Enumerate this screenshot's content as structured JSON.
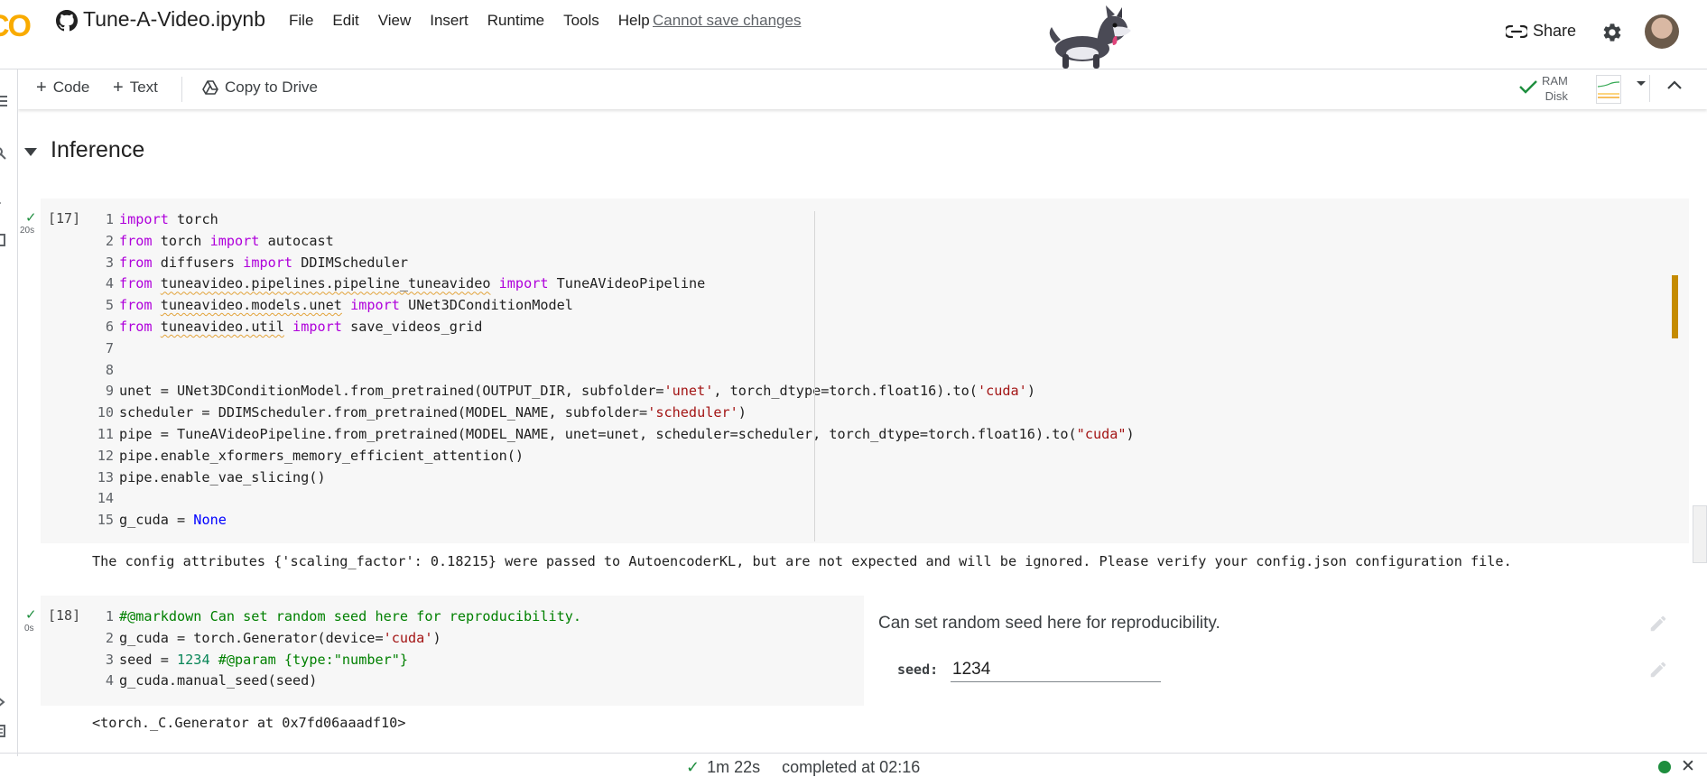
{
  "header": {
    "logo_text": "CO",
    "notebook_title": "Tune-A-Video.ipynb",
    "menu": [
      "File",
      "Edit",
      "View",
      "Insert",
      "Runtime",
      "Tools",
      "Help"
    ],
    "save_status": "Cannot save changes",
    "share_label": "Share",
    "icons": [
      "github-icon",
      "link-icon",
      "gear-icon",
      "avatar",
      "mascot-dog"
    ]
  },
  "toolbar": {
    "code_label": "Code",
    "text_label": "Text",
    "copy_to_drive_label": "Copy to Drive",
    "ram_label": "RAM",
    "disk_label": "Disk"
  },
  "section": {
    "title": "Inference"
  },
  "cell17": {
    "exec_count": "[17]",
    "run_time": "20s",
    "line_numbers": "1\n2\n3\n4\n5\n6\n7\n8\n9\n10\n11\n12\n13\n14\n15",
    "lines": [
      "import torch",
      "from torch import autocast",
      "from diffusers import DDIMScheduler",
      "from tuneavideo.pipelines.pipeline_tuneavideo import TuneAVideoPipeline",
      "from tuneavideo.models.unet import UNet3DConditionModel",
      "from tuneavideo.util import save_videos_grid",
      "",
      "",
      "unet = UNet3DConditionModel.from_pretrained(OUTPUT_DIR, subfolder='unet', torch_dtype=torch.float16).to('cuda')",
      "scheduler = DDIMScheduler.from_pretrained(MODEL_NAME, subfolder='scheduler')",
      "pipe = TuneAVideoPipeline.from_pretrained(MODEL_NAME, unet=unet, scheduler=scheduler, torch_dtype=torch.float16).to(\"cuda\")",
      "pipe.enable_xformers_memory_efficient_attention()",
      "pipe.enable_vae_slicing()",
      "",
      "g_cuda = None"
    ],
    "output": "The config attributes {'scaling_factor': 0.18215} were passed to AutoencoderKL, but are not expected and will be ignored. Please verify your config.json configuration file."
  },
  "cell18": {
    "exec_count": "[18]",
    "run_time": "0s",
    "line_numbers": "1\n2\n3\n4",
    "lines": [
      "#@markdown Can set random seed here for reproducibility.",
      "g_cuda = torch.Generator(device='cuda')",
      "seed = 1234 #@param {type:\"number\"}",
      "g_cuda.manual_seed(seed)"
    ],
    "form_heading": "Can set random seed here for reproducibility.",
    "seed_label": "seed:",
    "seed_value": "1234",
    "output": "<torch._C.Generator at 0x7fd06aaadf10>"
  },
  "status_bar": {
    "duration": "1m 22s",
    "completed": "completed at 02:16",
    "connection_color": "#1e8e3e"
  },
  "colors": {
    "keyword": "#af00db",
    "string": "#a31515",
    "number": "#098658",
    "comment": "#008000",
    "none": "#0000ff",
    "cell_background": "#f7f7f7",
    "success": "#1e8e3e"
  }
}
